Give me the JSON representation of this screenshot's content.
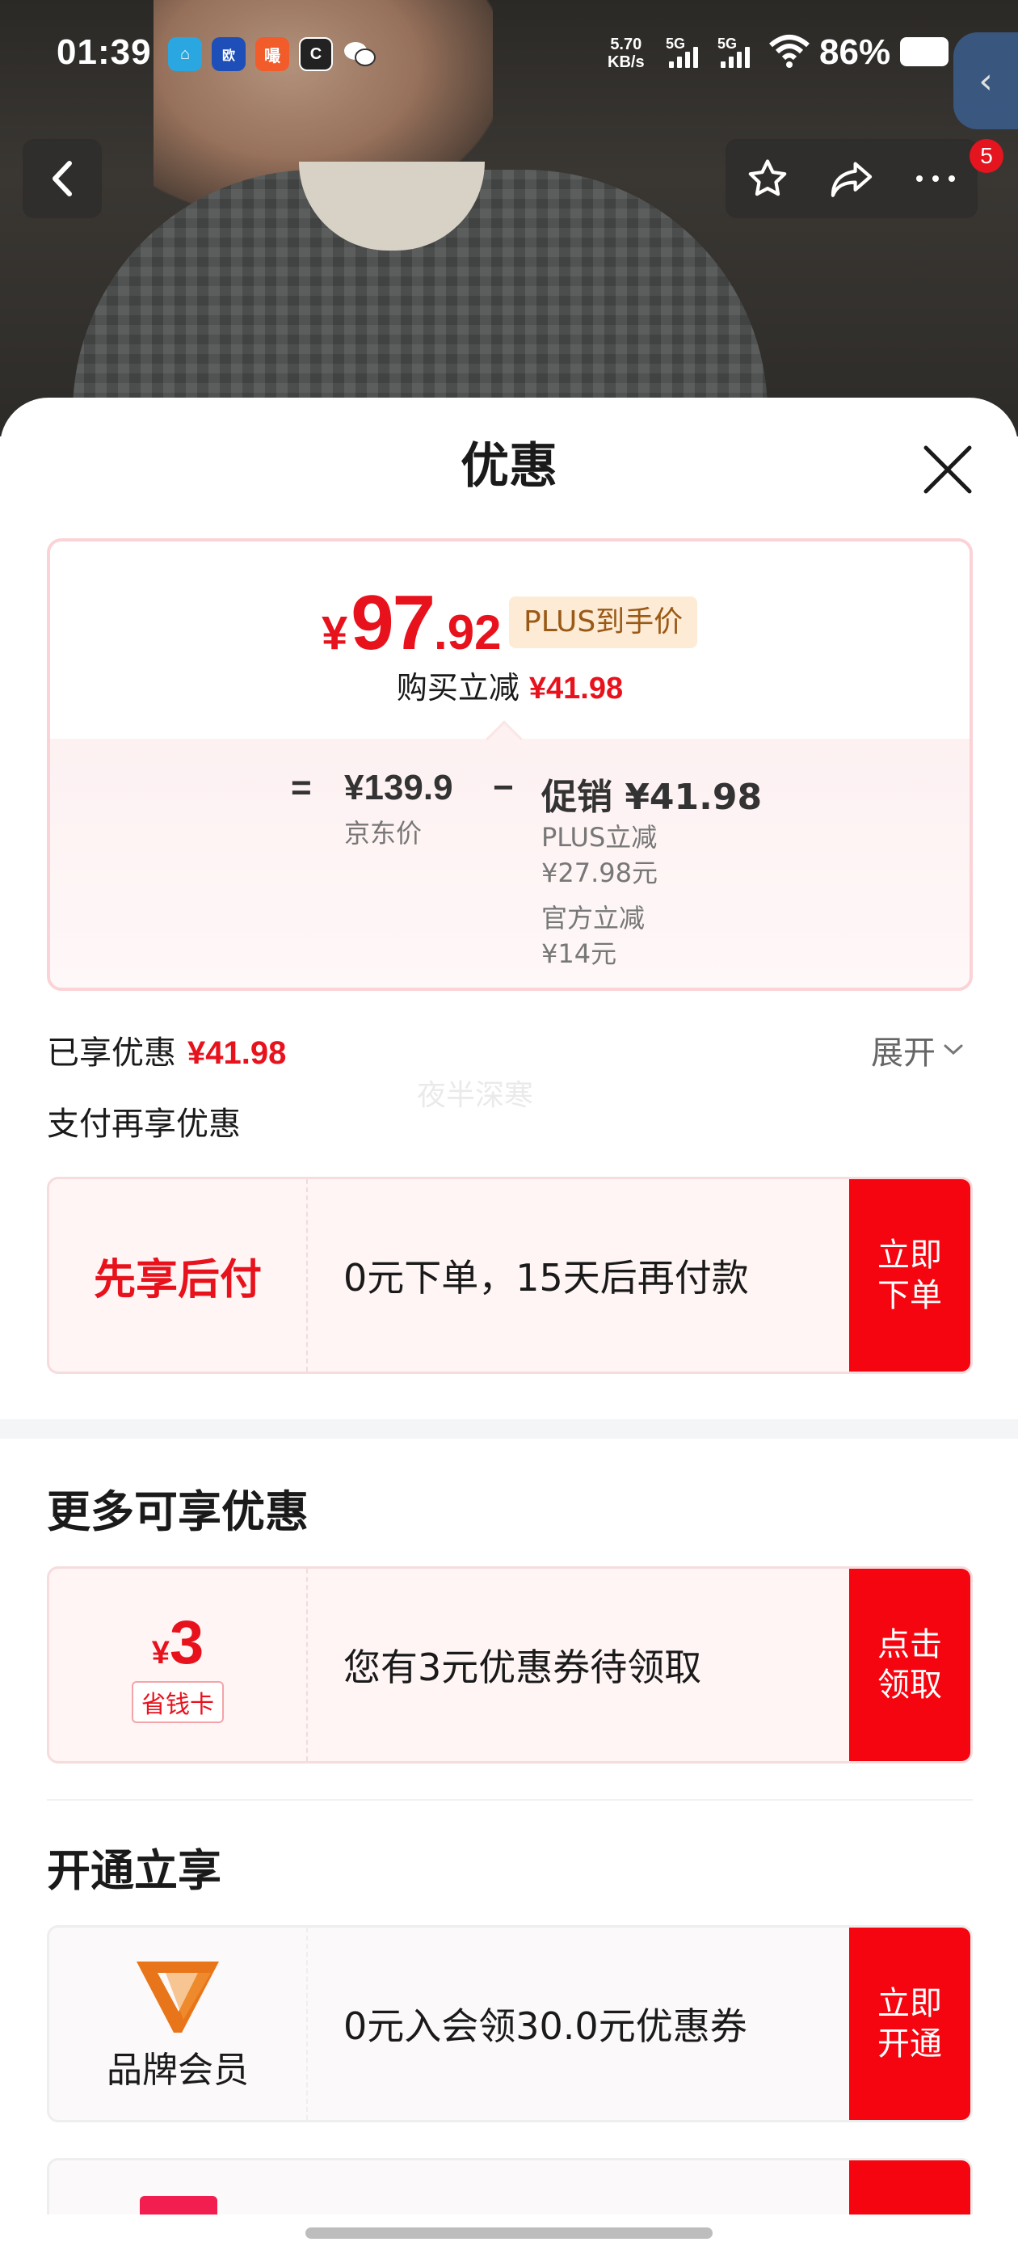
{
  "status_bar": {
    "time": "01:39",
    "apps": [
      {
        "name": "home-app-icon",
        "glyph": "⌂",
        "bg": "#2aa7e0"
      },
      {
        "name": "oupai-app-icon",
        "glyph": "欧",
        "bg": "#1e4fb8"
      },
      {
        "name": "xiao-app-icon",
        "glyph": "嘬",
        "bg": "#f25b2a"
      },
      {
        "name": "c-app-icon",
        "glyph": "C",
        "bg": "#222222"
      },
      {
        "name": "wechat-icon",
        "glyph": "✉",
        "bg": "transparent"
      }
    ],
    "net_speed_value": "5.70",
    "net_speed_unit": "KB/s",
    "sig1": "5G",
    "sig2": "5G",
    "battery": "86%"
  },
  "nav": {
    "badge_count": "5"
  },
  "sheet": {
    "title": "优惠",
    "price": {
      "currency": "¥",
      "integer": "97",
      "decimal": ".92",
      "tag": "PLUS到手价",
      "reduce_label": "购买立减",
      "reduce_amount": "¥41.98"
    },
    "breakdown": {
      "equals": "=",
      "jd_price": "¥139.9",
      "jd_label": "京东价",
      "minus": "−",
      "promo_title": "促销 ¥41.98",
      "plus_label": "PLUS立减",
      "plus_amount": "¥27.98元",
      "official_label": "官方立减",
      "official_amount": "¥14元"
    },
    "enjoyed_label": "已享优惠",
    "enjoyed_amount": "¥41.98",
    "expand_label": "展开",
    "watermark": "夜半深寒",
    "pay_title": "支付再享优惠",
    "bnpl": {
      "label": "先享后付",
      "desc": "0元下单，15天后再付款",
      "cta_line1": "立即",
      "cta_line2": "下单"
    },
    "more_title": "更多可享优惠",
    "coupon": {
      "currency": "¥",
      "amount": "3",
      "tag": "省钱卡",
      "desc": "您有3元优惠券待领取",
      "cta_line1": "点击",
      "cta_line2": "领取"
    },
    "open_title": "开通立享",
    "brand": {
      "name": "品牌会员",
      "desc": "0元入会领30.0元优惠券",
      "cta_line1": "立即",
      "cta_line2": "开通"
    }
  },
  "colors": {
    "accent_red": "#e8121d",
    "cta_red": "#f5050f",
    "plus_tag_bg": "#fdebd6",
    "brand_orange": "#e8751a"
  }
}
